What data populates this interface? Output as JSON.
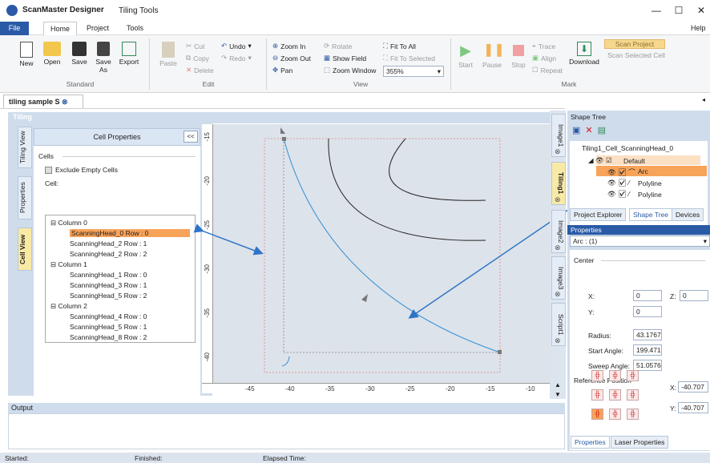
{
  "app": {
    "title": "ScanMaster Designer",
    "context": "Tiling Tools",
    "help": "Help"
  },
  "menu": {
    "file": "File",
    "tabs": [
      "Home",
      "Project",
      "Tools"
    ]
  },
  "ribbon": {
    "standard": {
      "new": "New",
      "open": "Open",
      "save": "Save",
      "save_as": "Save As",
      "export": "Export",
      "group": "Standard"
    },
    "edit": {
      "paste": "Paste",
      "cut": "Cut",
      "copy": "Copy",
      "delete": "Delete",
      "undo": "Undo",
      "redo": "Redo",
      "group": "Edit"
    },
    "view": {
      "zoom_in": "Zoom In",
      "zoom_out": "Zoom Out",
      "pan": "Pan",
      "rotate": "Rotate",
      "show_field": "Show Field",
      "zoom_window": "Zoom Window",
      "fit_to_all": "Fit To All",
      "fit_to_selected": "Fit To Selected",
      "zoom_value": "355%",
      "group": "View"
    },
    "mark": {
      "start": "Start",
      "pause": "Pause",
      "stop": "Stop",
      "trace": "Trace",
      "align": "Align",
      "repeat": "Repeat",
      "download": "Download",
      "scan_project": "Scan Project",
      "scan_selected": "Scan Selected Cell",
      "group": "Mark"
    }
  },
  "doc_tab": "tiling sample S",
  "tiling_header": "Tiling",
  "left_vtabs": [
    "Tiling View",
    "Properties",
    "Cell View"
  ],
  "cell_props": {
    "title": "Cell Properties",
    "collapse": "<<",
    "section": "Cells",
    "exclude_empty": "Exclude Empty Cells",
    "cell_label": "Cell:",
    "tree": [
      {
        "text": "⊟  Column  0",
        "indent": 0
      },
      {
        "text": "ScanningHead_0   Row : 0",
        "indent": 1,
        "selected": true
      },
      {
        "text": "ScanningHead_2   Row : 1",
        "indent": 1
      },
      {
        "text": "ScanningHead_2   Row : 2",
        "indent": 1
      },
      {
        "text": "⊟  Column  1",
        "indent": 0
      },
      {
        "text": "ScanningHead_1   Row : 0",
        "indent": 1
      },
      {
        "text": "ScanningHead_3   Row : 1",
        "indent": 1
      },
      {
        "text": "ScanningHead_5   Row : 2",
        "indent": 1
      },
      {
        "text": "⊟  Column  2",
        "indent": 0
      },
      {
        "text": "ScanningHead_4   Row : 0",
        "indent": 1
      },
      {
        "text": "ScanningHead_5   Row : 1",
        "indent": 1
      },
      {
        "text": "ScanningHead_8   Row : 2",
        "indent": 1
      }
    ]
  },
  "ruler": {
    "v": [
      "-15",
      "-20",
      "-25",
      "-30",
      "-35",
      "-40"
    ],
    "h": [
      "-45",
      "-40",
      "-35",
      "-30",
      "-25",
      "-20",
      "-15",
      "-10"
    ]
  },
  "right_vtabs": [
    "Image1",
    "Tiling1",
    "Image2",
    "Image3",
    "Script1"
  ],
  "output": {
    "title": "Output"
  },
  "status": {
    "started": "Started:",
    "finished": "Finished:",
    "elapsed": "Elapsed Time:"
  },
  "shape_tree": {
    "title": "Shape Tree",
    "root": "Tiling1_Cell_ScanningHead_0",
    "items": [
      "Default",
      "Arc",
      "Polyline",
      "Polyline"
    ],
    "tabs": [
      "Project Explorer",
      "Shape Tree",
      "Devices"
    ]
  },
  "properties": {
    "title": "Properties",
    "selector": "Arc : (1)",
    "center": "Center",
    "x_label": "X:",
    "x": "0",
    "y_label": "Y:",
    "y": "0",
    "z_label": "Z:",
    "z": "0",
    "radius_label": "Radius:",
    "radius": "43.1767",
    "start_label": "Start Angle:",
    "start": "199.471",
    "sweep_label": "Sweep Angle:",
    "sweep": "51.0576",
    "ref_pos": "Reference Position",
    "ref_x_label": "X:",
    "ref_x": "-40.707",
    "ref_y_label": "Y:",
    "ref_y": "-40.707",
    "tabs": [
      "Properties",
      "Laser Properties"
    ]
  },
  "colors": {
    "accent": "#2a5aa6",
    "selection": "#f7a35a",
    "arc": "#2f8fd6",
    "panel": "#cfdcec"
  }
}
